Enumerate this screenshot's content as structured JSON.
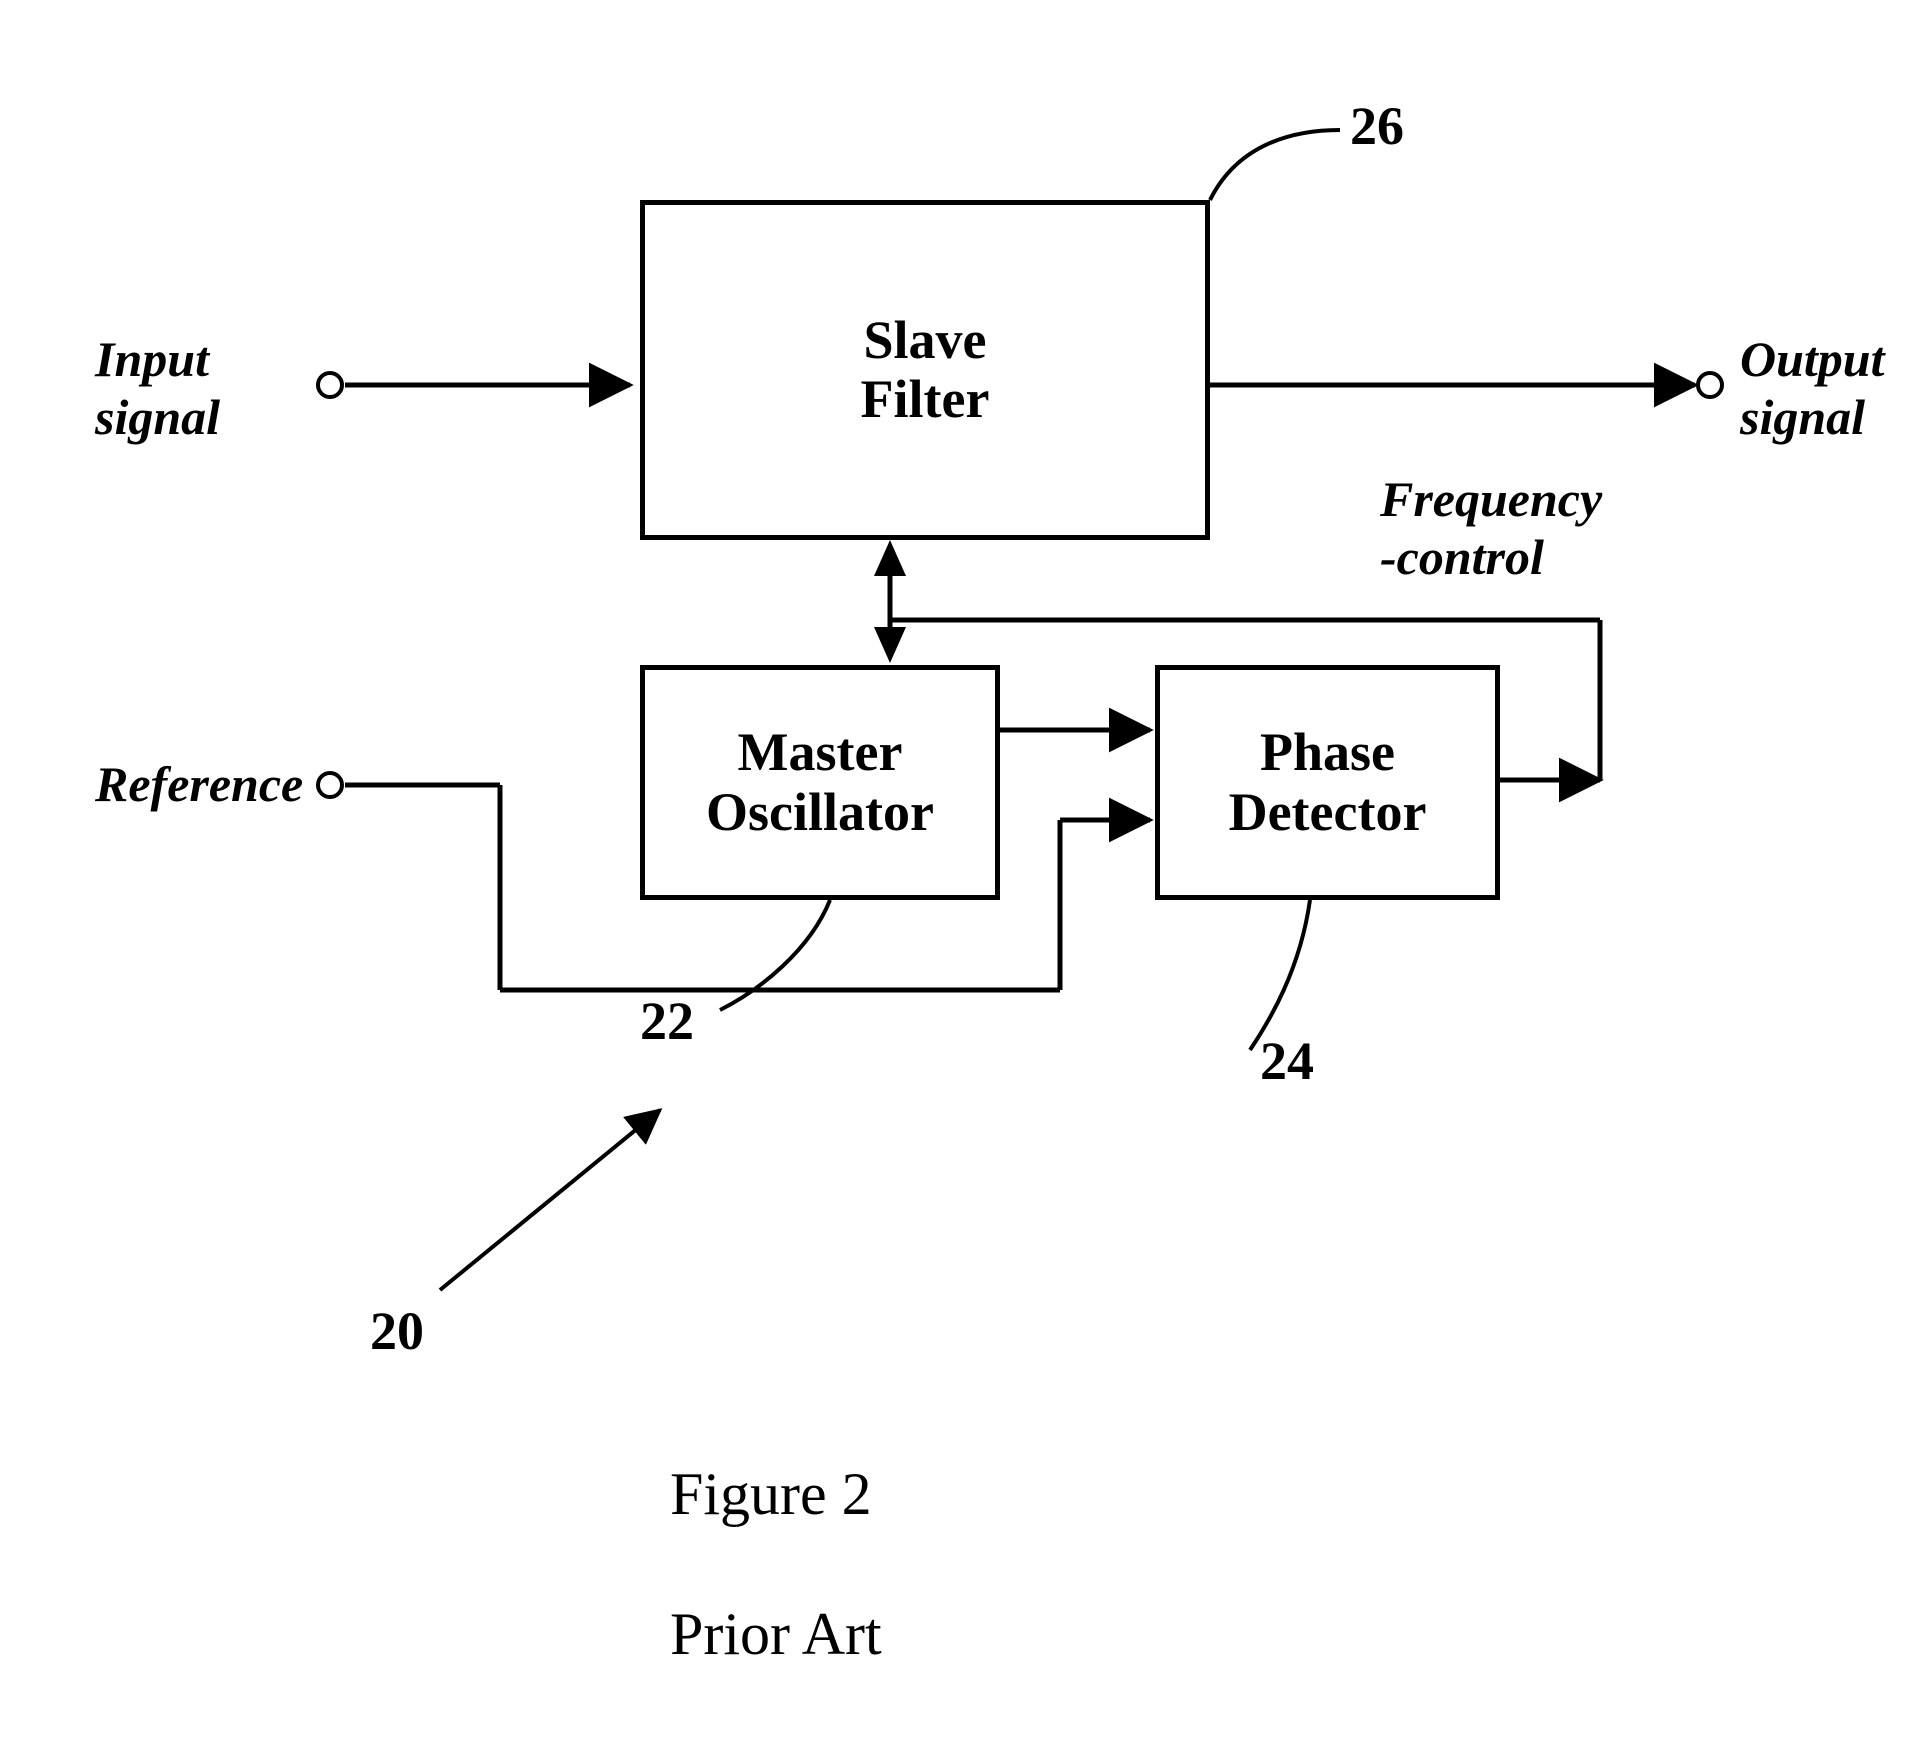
{
  "labels": {
    "input": "Input\nsignal",
    "output": "Output\nsignal",
    "reference": "Reference",
    "freqctrl": "Frequency\n-control"
  },
  "blocks": {
    "slave": "Slave\nFilter",
    "master": "Master\nOscillator",
    "phase": "Phase\nDetector"
  },
  "refnums": {
    "slave": "26",
    "master": "22",
    "phase": "24",
    "system": "20"
  },
  "caption": {
    "line1": "Figure 2",
    "line2": "Prior Art"
  }
}
